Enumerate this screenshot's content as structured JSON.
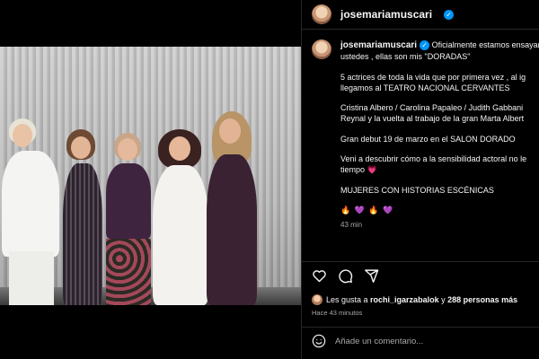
{
  "post": {
    "username": "josemariamuscari",
    "caption_lead": "Oficialmente estamos ensayan",
    "caption_lines": [
      "ustedes , ellas son mis \"DORADAS\"",
      "5 actrices de toda la vida que por primera vez , al ig",
      "llegamos al TEATRO NACIONAL CERVANTES",
      "Cristina Albero / Carolina Papaleo / Judith Gabbani",
      "Reynal y la vuelta al trabajo de la gran Marta Albert",
      "Gran debut 19 de marzo en el SALON DORADO",
      "Veni a descubrir cómo a la sensibilidad actoral no le",
      "tiempo",
      "MUJERES CON HISTORIAS ESCÉNICAS"
    ],
    "emoji_row": "🔥 💜 🔥 💜",
    "heart_emoji": "💗",
    "caption_time": "43 min",
    "likes_prefix": "Les gusta a ",
    "likes_user": "rochi_igarzabalok",
    "likes_middle": " y ",
    "likes_count": "288 personas más",
    "posted_time": "Hace 43 minutos",
    "comment_placeholder": "Añade un comentario..."
  },
  "icons": {
    "like": "heart-outline-icon",
    "comment": "comment-bubble-icon",
    "share": "paper-plane-icon",
    "emoji": "smiley-icon",
    "verified": "verified-badge-icon"
  },
  "colors": {
    "background": "#000000",
    "text": "#f5f5f5",
    "muted": "#a8a8a8",
    "verified": "#0095f6",
    "divider": "#262626"
  }
}
